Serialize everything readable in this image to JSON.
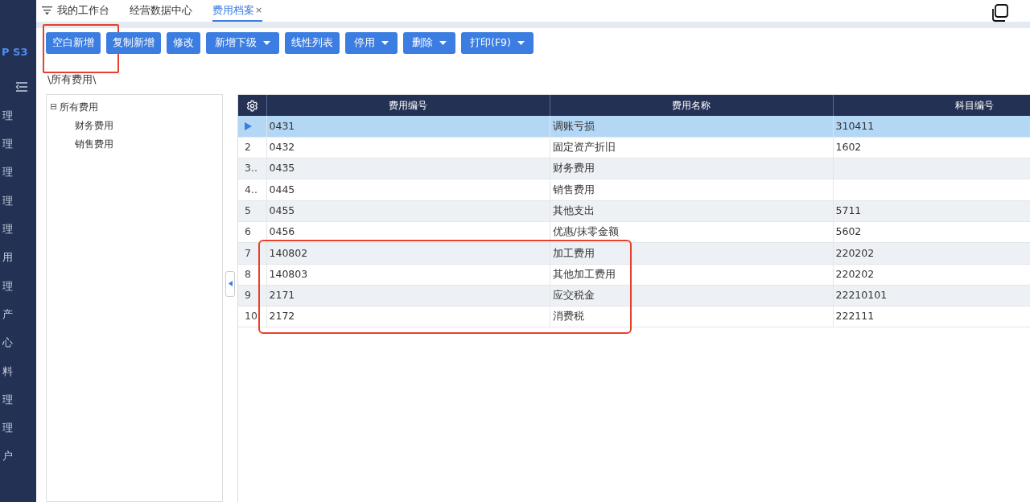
{
  "sidebar": {
    "logo": "P S3",
    "items": [
      "理",
      "理",
      "理",
      "理",
      "理",
      "用",
      "理",
      "产",
      "心",
      "料",
      "理",
      "理",
      "户"
    ]
  },
  "tabs": [
    {
      "label": "我的工作台",
      "selected": false,
      "closable": false
    },
    {
      "label": "经营数据中心",
      "selected": false,
      "closable": false
    },
    {
      "label": "费用档案",
      "selected": true,
      "closable": true,
      "close": "×"
    }
  ],
  "toolbar": [
    {
      "label": "空白新增",
      "dropdown": false,
      "highlighted": true
    },
    {
      "label": "复制新增",
      "dropdown": false,
      "highlighted": false
    },
    {
      "label": "修改",
      "dropdown": false,
      "highlighted": false
    },
    {
      "label": "新增下级",
      "dropdown": true,
      "highlighted": false
    },
    {
      "label": "线性列表",
      "dropdown": false,
      "highlighted": false
    },
    {
      "label": "停用",
      "dropdown": true,
      "highlighted": false
    },
    {
      "label": "删除",
      "dropdown": true,
      "highlighted": false
    },
    {
      "label": "打印(F9)",
      "dropdown": true,
      "highlighted": false
    }
  ],
  "breadcrumb": "\\所有费用\\",
  "tree": [
    {
      "label": "所有费用",
      "expanded": true,
      "toggle": "⊟",
      "children": [
        {
          "label": "财务费用"
        },
        {
          "label": "销售费用"
        }
      ]
    }
  ],
  "table": {
    "columns": [
      "费用编号",
      "费用名称",
      "科目编号"
    ],
    "rows": [
      {
        "selected": true,
        "highlighted": false,
        "cells": [
          "0431",
          "调账亏损",
          "310411"
        ]
      },
      {
        "number": "2",
        "selected": false,
        "highlighted": false,
        "cells": [
          "0432",
          "固定资产折旧",
          "1602"
        ]
      },
      {
        "number": "3..",
        "selected": false,
        "highlighted": false,
        "cells": [
          "0435",
          "财务费用",
          ""
        ]
      },
      {
        "number": "4..",
        "selected": false,
        "highlighted": false,
        "cells": [
          "0445",
          "销售费用",
          ""
        ]
      },
      {
        "number": "5",
        "selected": false,
        "highlighted": false,
        "cells": [
          "0455",
          "其他支出",
          "5711"
        ]
      },
      {
        "number": "6",
        "selected": false,
        "highlighted": false,
        "cells": [
          "0456",
          "优惠/抹零金额",
          "5602"
        ]
      },
      {
        "number": "7",
        "selected": false,
        "highlighted": true,
        "cells": [
          "140802",
          "加工费用",
          "220202"
        ]
      },
      {
        "number": "8",
        "selected": false,
        "highlighted": true,
        "cells": [
          "140803",
          "其他加工费用",
          "220202"
        ]
      },
      {
        "number": "9",
        "selected": false,
        "highlighted": true,
        "cells": [
          "2171",
          "应交税金",
          "22210101"
        ]
      },
      {
        "number": "10",
        "selected": false,
        "highlighted": true,
        "cells": [
          "2172",
          "消费税",
          "222111"
        ]
      }
    ]
  }
}
